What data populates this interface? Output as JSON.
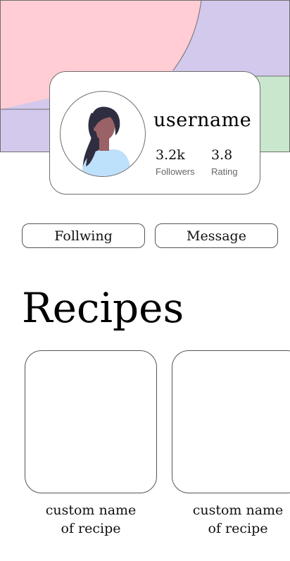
{
  "banner": {
    "colors": {
      "pink": "#ffcdd3",
      "lavender": "#d3c9ec",
      "green": "#c9e7cc"
    }
  },
  "profile": {
    "username": "username",
    "followers_value": "3.2k",
    "followers_label": "Followers",
    "rating_value": "3.8",
    "rating_label": "Rating",
    "avatar_icon": "woman-avatar-illustration"
  },
  "actions": {
    "following_label": "Follwing",
    "message_label": "Message"
  },
  "recipes": {
    "title": "Recipes",
    "items": [
      {
        "name_line1": "custom name",
        "name_line2": "of recipe"
      },
      {
        "name_line1": "custom name",
        "name_line2": "of recipe"
      }
    ]
  }
}
